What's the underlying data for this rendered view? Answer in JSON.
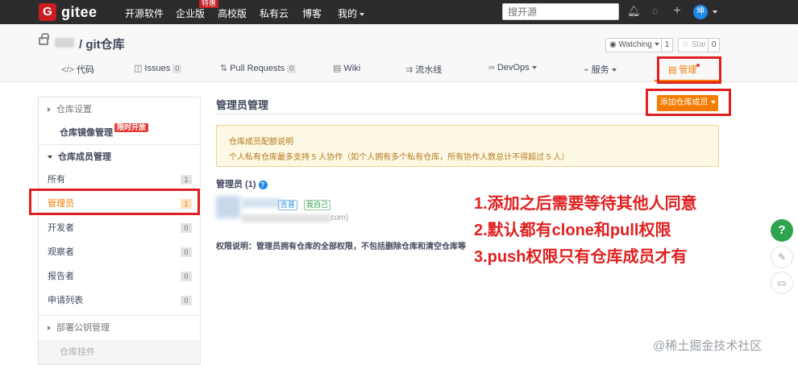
{
  "topnav": {
    "logo_letter": "G",
    "logo_text": "gitee",
    "items": [
      "开源软件",
      "企业版",
      "高校版",
      "私有云",
      "博客",
      "我的"
    ],
    "enterprise_badge": "特惠",
    "search_placeholder": "搜开源",
    "avatar_text": "坤"
  },
  "repo": {
    "name": "/ git仓库",
    "watch_label": "Watching",
    "watch_count": "1",
    "star_label": "Star",
    "star_count": "0"
  },
  "tabs": [
    {
      "icon": "</>",
      "label": "代码"
    },
    {
      "icon": "◫",
      "label": "Issues",
      "count": "0"
    },
    {
      "icon": "⇅",
      "label": "Pull Requests",
      "count": "0"
    },
    {
      "icon": "▤",
      "label": "Wiki"
    },
    {
      "icon": "⇉",
      "label": "流水线"
    },
    {
      "icon": "∞",
      "label": "DevOps"
    },
    {
      "icon": "⌁",
      "label": "服务"
    },
    {
      "icon": "▤",
      "label": "管理"
    }
  ],
  "sidebar": {
    "repo_settings": "仓库设置",
    "mirror": "仓库镜像管理",
    "mirror_badge": "限时开放",
    "members_section": "仓库成员管理",
    "items": [
      {
        "label": "所有",
        "count": "1"
      },
      {
        "label": "管理员",
        "count": "1"
      },
      {
        "label": "开发者",
        "count": "0"
      },
      {
        "label": "观察者",
        "count": "0"
      },
      {
        "label": "报告者",
        "count": "0"
      },
      {
        "label": "申请列表",
        "count": "0"
      }
    ],
    "deploy_keys": "部署公钥管理",
    "repo_plugins": "仓库挂件"
  },
  "main": {
    "title": "管理员管理",
    "add_button": "添加仓库成员",
    "notice_title": "仓库成员配额说明",
    "notice_text": "个人私有仓库最多支持 5 人协作（如个人拥有多个私有仓库，所有协作人数总计不得超过 5 人）",
    "admins_label": "管理员 (1)",
    "member_tag_blue": "吉普",
    "member_tag_green": "我自己",
    "member_email_suffix": "com)",
    "perm_note": "权限说明：管理员拥有仓库的全部权限，不包括删除仓库和清空仓库等"
  },
  "annotations": [
    "1.添加之后需要等待其他人同意",
    "2.默认都有clone和pull权限",
    "3.push权限只有仓库成员才有"
  ],
  "fab": {
    "help": "?"
  },
  "watermark": "@稀土掘金技术社区",
  "colors": {
    "accent": "#f57c00",
    "brand": "#c71d23",
    "annotation": "#e02020",
    "nav_bg": "#2c2c2c"
  }
}
